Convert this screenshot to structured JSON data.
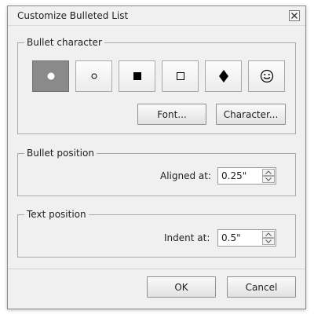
{
  "dialog": {
    "title": "Customize Bulleted List",
    "close_icon": "close-icon"
  },
  "bullet_character": {
    "legend": "Bullet character",
    "bullets": [
      {
        "name": "filled-circle",
        "glyph": "●",
        "selected": true
      },
      {
        "name": "hollow-circle",
        "glyph": "◦",
        "selected": false
      },
      {
        "name": "filled-square",
        "glyph": "■",
        "selected": false
      },
      {
        "name": "hollow-square",
        "glyph": "□",
        "selected": false
      },
      {
        "name": "diamond",
        "glyph": "♦",
        "selected": false
      },
      {
        "name": "smiley",
        "glyph": "☺",
        "selected": false
      }
    ],
    "font_button": "Font...",
    "character_button": "Character..."
  },
  "bullet_position": {
    "legend": "Bullet position",
    "aligned_label": "Aligned at:",
    "aligned_value": "0.25\""
  },
  "text_position": {
    "legend": "Text position",
    "indent_label": "Indent at:",
    "indent_value": "0.5\""
  },
  "footer": {
    "ok_label": "OK",
    "cancel_label": "Cancel"
  },
  "colors": {
    "selected_bullet_bg": "#8a8a8a",
    "dialog_bg": "#f0f0f0"
  }
}
